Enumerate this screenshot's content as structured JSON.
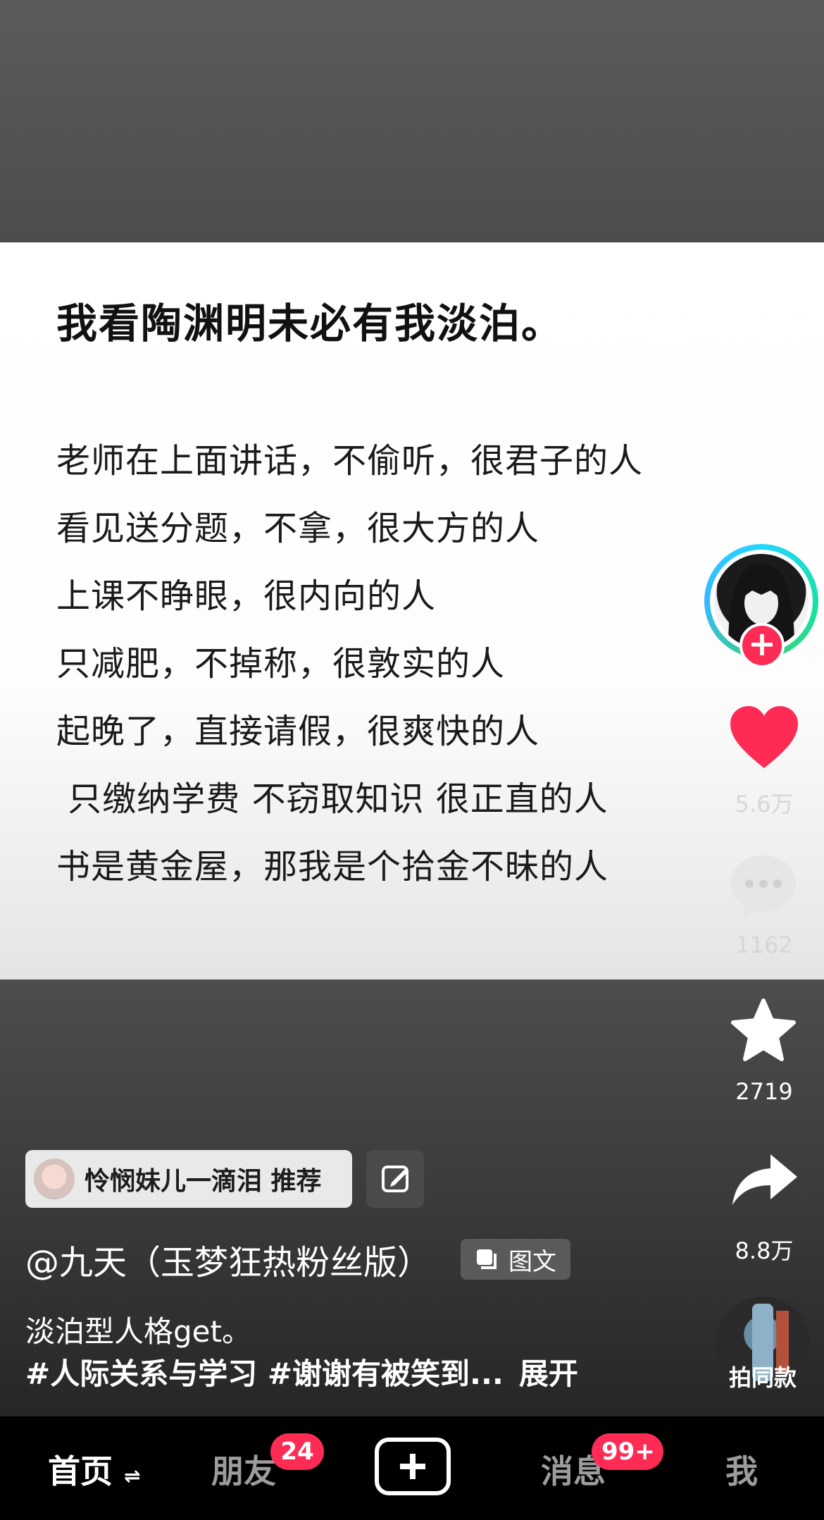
{
  "note": {
    "title": "我看陶渊明未必有我淡泊。",
    "lines": [
      "老师在上面讲话，不偷听，很君子的人",
      "看见送分题，不拿，很大方的人",
      "上课不睁眼，很内向的人",
      "只减肥，不掉称，很敦实的人",
      "起晚了，直接请假，很爽快的人",
      " 只缴纳学费 不窃取知识 很正直的人",
      "书是黄金屋，那我是个拾金不昧的人"
    ]
  },
  "rail": {
    "likes": "5.6万",
    "comments": "1162",
    "favorites": "2719",
    "shares": "8.8万",
    "same_style_label": "拍同款"
  },
  "recommend": {
    "text": "怜悯妹儿一滴泪  推荐"
  },
  "post": {
    "author": "@九天（玉梦狂热粉丝版）",
    "type_label": "图文",
    "caption": "淡泊型人格get。",
    "hashtags": "#人际关系与学习 #谢谢有被笑到...",
    "expand_label": "展开"
  },
  "tabs": {
    "home": "首页",
    "friends": "朋友",
    "friends_badge": "24",
    "messages": "消息",
    "messages_badge": "99+",
    "me": "我"
  },
  "colors": {
    "accent": "#fe2c55",
    "like": "#fe2c55"
  }
}
